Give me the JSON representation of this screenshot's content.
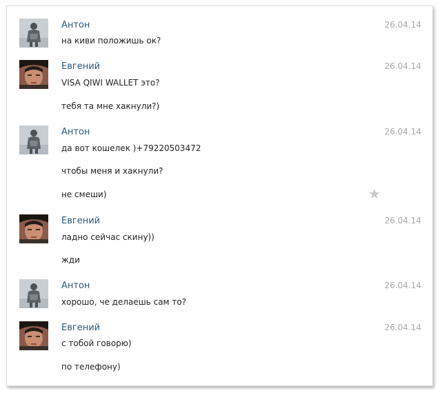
{
  "messages": [
    {
      "author": "Антон",
      "avatar": "anton",
      "date": "26.04.14",
      "lines": [
        "на киви положишь ок?"
      ]
    },
    {
      "author": "Евгений",
      "avatar": "evgeny",
      "date": "26.04.14",
      "lines": [
        "VISA QIWI WALLET это?",
        "тебя та мне хакнули?)"
      ]
    },
    {
      "author": "Антон",
      "avatar": "anton",
      "date": "26.04.14",
      "lines": [
        "да вот кошелек )+79220503472",
        "чтобы меня и хакнули?",
        "не смеши)"
      ]
    },
    {
      "author": "Евгений",
      "avatar": "evgeny",
      "date": "26.04.14",
      "lines": [
        "ладно сейчас скину))",
        "жди"
      ]
    },
    {
      "author": "Антон",
      "avatar": "anton",
      "date": "26.04.14",
      "lines": [
        "хорошо, че делаешь сам то?"
      ]
    },
    {
      "author": "Евгений",
      "avatar": "evgeny",
      "date": "26.04.14",
      "lines": [
        "с тобой говорю)",
        "по телефону)"
      ]
    }
  ],
  "icons": {
    "favorite": "star-icon"
  },
  "colors": {
    "author": "#2b587a",
    "date": "#a8a8a8",
    "text": "#222222",
    "star": "#c6c9cc"
  }
}
